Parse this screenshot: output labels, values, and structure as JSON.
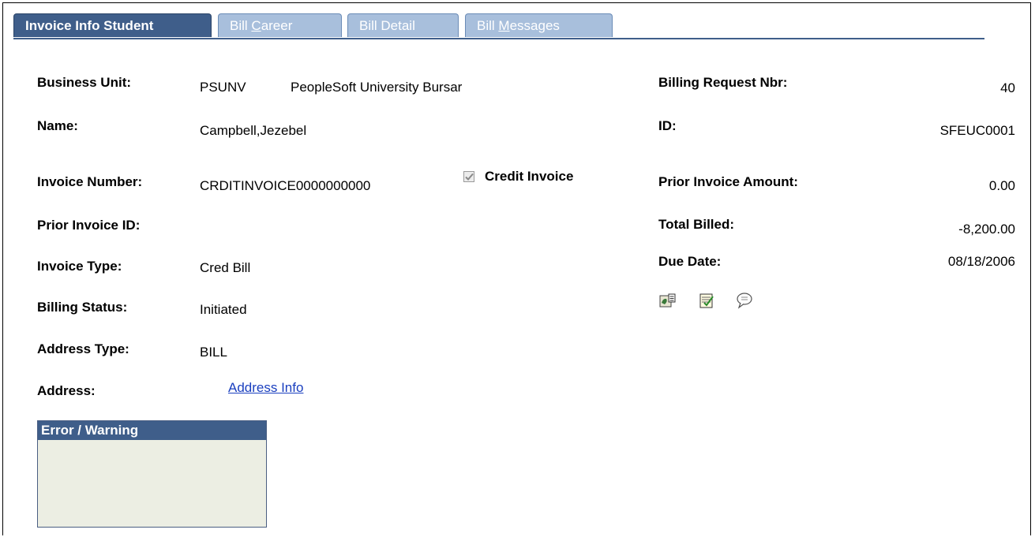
{
  "tabs": [
    {
      "label": "Invoice Info Student"
    },
    {
      "pre": "Bill ",
      "u": "C",
      "post": "areer"
    },
    {
      "label": "Bill Detail"
    },
    {
      "pre": "Bill ",
      "u": "M",
      "post": "essages"
    }
  ],
  "left_fields": {
    "business_unit_label": "Business Unit:",
    "business_unit_code": "PSUNV",
    "business_unit_desc": "PeopleSoft University Bursar",
    "name_label": "Name:",
    "name_value": "Campbell,Jezebel",
    "invoice_number_label": "Invoice Number:",
    "invoice_number_value": "CRDITINVOICE0000000000",
    "credit_invoice_label": "Credit Invoice",
    "prior_invoice_id_label": "Prior Invoice ID:",
    "invoice_type_label": "Invoice Type:",
    "invoice_type_value": "Cred Bill",
    "billing_status_label": "Billing Status:",
    "billing_status_value": "Initiated",
    "address_type_label": "Address Type:",
    "address_type_value": "BILL",
    "address_label": "Address:",
    "address_link": "Address Info"
  },
  "right_fields": {
    "billing_request_label": "Billing Request Nbr:",
    "billing_request_value": "40",
    "id_label": "ID:",
    "id_value": "SFEUC0001",
    "prior_invoice_amount_label": "Prior Invoice Amount:",
    "prior_invoice_amount_value": "0.00",
    "total_billed_label": "Total Billed:",
    "total_billed_value": "-8,200.00",
    "due_date_label": "Due Date:",
    "due_date_value": "08/18/2006"
  },
  "icons": [
    "contact-icon",
    "notepad-icon",
    "comments-icon"
  ],
  "error_box": {
    "title": "Error / Warning"
  },
  "credit_invoice_checked": true
}
